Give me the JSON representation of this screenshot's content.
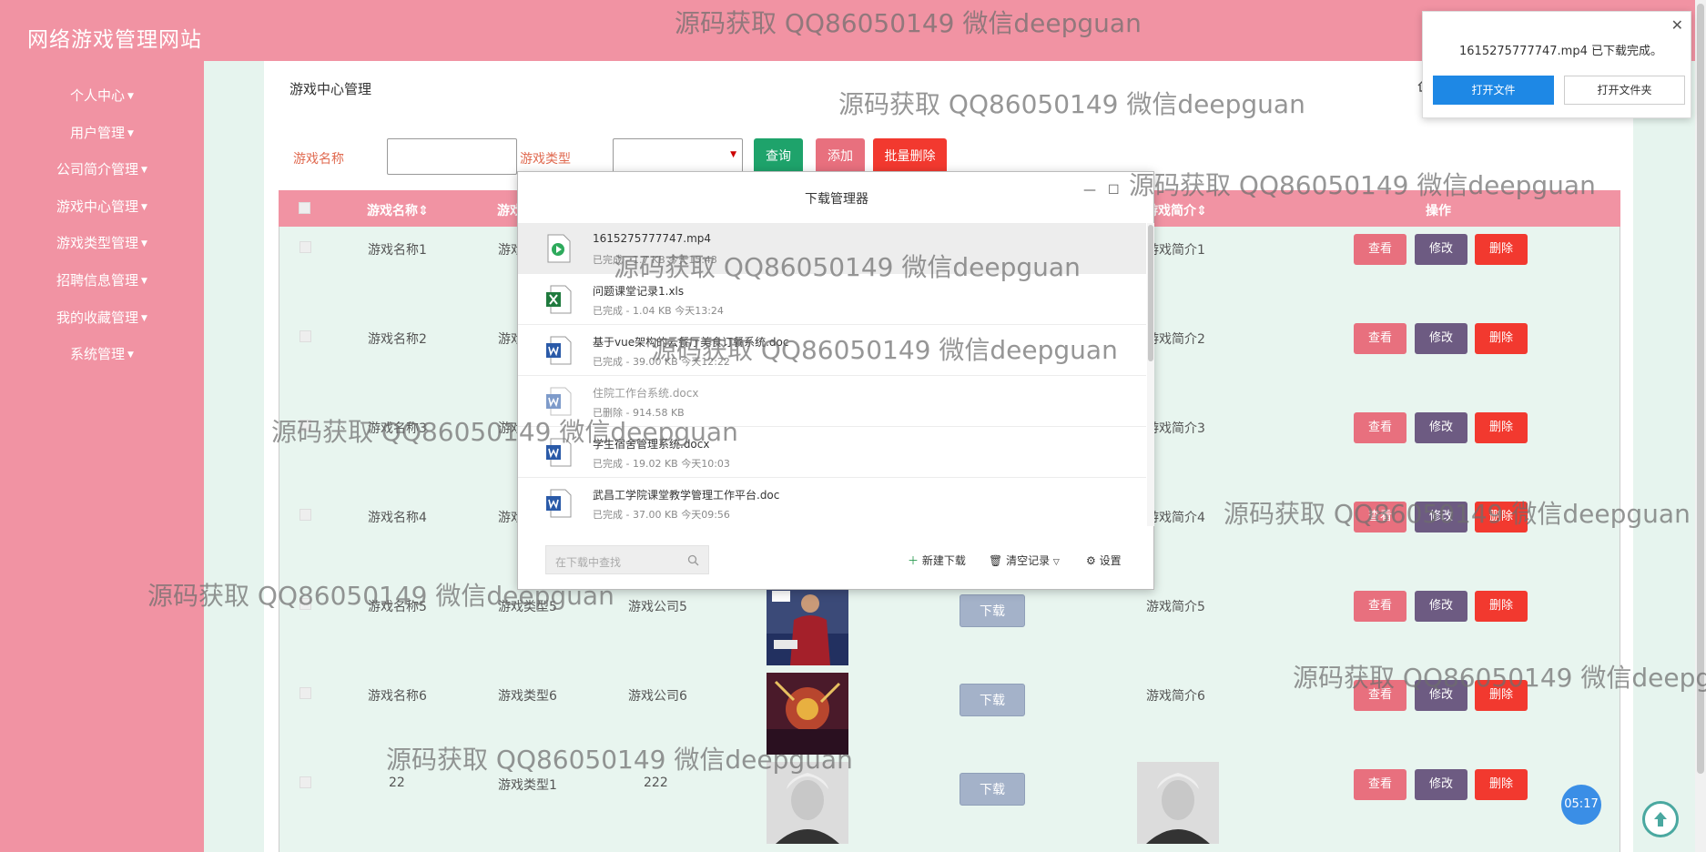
{
  "site_title": "网络游戏管理网站",
  "sidebar": {
    "items": [
      {
        "label": "个人中心"
      },
      {
        "label": "用户管理"
      },
      {
        "label": "公司简介管理"
      },
      {
        "label": "游戏中心管理"
      },
      {
        "label": "游戏类型管理"
      },
      {
        "label": "招聘信息管理"
      },
      {
        "label": "我的收藏管理"
      },
      {
        "label": "系统管理"
      }
    ]
  },
  "page_title": "游戏中心管理",
  "search": {
    "name_label": "游戏名称",
    "type_label": "游戏类型",
    "query_btn": "查询",
    "add_btn": "添加",
    "batch_delete_btn": "批量删除"
  },
  "table": {
    "headers": {
      "name": "游戏名称",
      "type": "游戏",
      "intro": "游戏简介",
      "ops": "操作"
    },
    "rows": [
      {
        "name": "游戏名称1",
        "type": "游戏",
        "company": "",
        "intro": "游戏简介1"
      },
      {
        "name": "游戏名称2",
        "type": "游戏",
        "company": "",
        "intro": "游戏简介2"
      },
      {
        "name": "游戏名称3",
        "type": "游戏",
        "company": "",
        "intro": "游戏简介3"
      },
      {
        "name": "游戏名称4",
        "type": "游戏",
        "company": "",
        "intro": "游戏简介4"
      },
      {
        "name": "游戏名称5",
        "type": "游戏类型5",
        "company": "游戏公司5",
        "intro": "游戏简介5"
      },
      {
        "name": "游戏名称6",
        "type": "游戏类型6",
        "company": "游戏公司6",
        "intro": "游戏简介6"
      },
      {
        "name": "22",
        "type": "游戏类型1",
        "company": "222",
        "intro": ""
      }
    ],
    "view_label": "查看",
    "edit_label": "修改",
    "delete_label": "删除",
    "download_label": "下载"
  },
  "download_manager": {
    "title": "下载管理器",
    "items": [
      {
        "name": "1615275777747.mp4",
        "meta": "已完成 - 1.7 KB  今天15:43",
        "icon": "video-file-icon"
      },
      {
        "name": "问题课堂记录1.xls",
        "meta": "已完成 - 1.04 KB   今天13:24",
        "icon": "excel-file-icon"
      },
      {
        "name": "基于vue架构的云餐厅美食订餐系统.doc",
        "meta": "已完成 - 39.00 KB   今天12:22",
        "icon": "word-file-icon"
      },
      {
        "name": "住院工作台系统.docx",
        "meta": "已删除 - 914.58 KB",
        "icon": "word-file-icon"
      },
      {
        "name": "学生宿舍管理系统.docx",
        "meta": "已完成 - 19.02 KB   今天10:03",
        "icon": "word-file-icon"
      },
      {
        "name": "武昌工学院课堂教学管理工作平台.doc",
        "meta": "已完成 - 37.00 KB   今天09:56",
        "icon": "word-file-icon"
      }
    ],
    "search_placeholder": "在下载中查找",
    "new_download": "新建下载",
    "clear_records": "清空记录",
    "settings": "设置"
  },
  "popup": {
    "message": "1615275777747.mp4 已下载完成。",
    "open_file": "打开文件",
    "open_folder": "打开文件夹"
  },
  "watermark_text": "源码获取 QQ86050149 微信deepguan",
  "clock": "05:17",
  "colors": {
    "primary": "#f193a3",
    "bg": "#e6f4ee",
    "view": "#e8707e",
    "edit": "#6d5b82",
    "delete": "#f2392f",
    "query": "#1ea36b",
    "batch_delete": "#f2392f"
  }
}
